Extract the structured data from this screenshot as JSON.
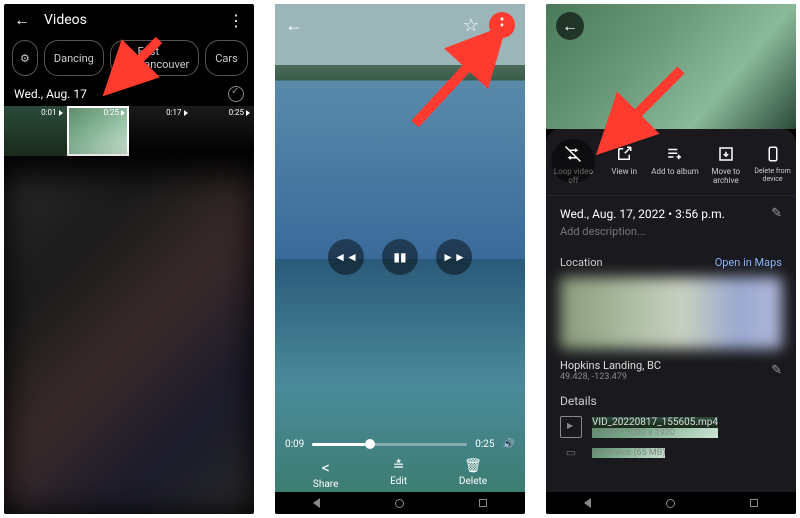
{
  "screen1": {
    "title": "Videos",
    "chips": {
      "filter_icon": "≡",
      "dancing": "Dancing",
      "east_van": "East Vancouver",
      "cars": "Cars"
    },
    "date_header": "Wed., Aug. 17",
    "thumbs": [
      "0:01",
      "0:25",
      "0:17",
      "0:25"
    ]
  },
  "screen2": {
    "playback": {
      "elapsed": "0:09",
      "total": "0:25"
    },
    "actions": {
      "share": "Share",
      "edit": "Edit",
      "delete": "Delete"
    }
  },
  "screen3": {
    "actions": {
      "loop": "Loop video off",
      "viewin": "View in",
      "addalbum": "Add to album",
      "archive": "Move to archive",
      "delete": "Delete from device"
    },
    "datetime": "Wed., Aug. 17, 2022 • 3:56 p.m.",
    "add_description": "Add description...",
    "location_label": "Location",
    "open_maps": "Open in Maps",
    "place_name": "Hopkins Landing, BC",
    "coords": "49.428, -123.479",
    "details_label": "Details",
    "filename": "VID_20220817_155605.mp4",
    "filemeta": "2.1MP • 1080 x 1920",
    "ondevice": "On device (65 MB)"
  }
}
